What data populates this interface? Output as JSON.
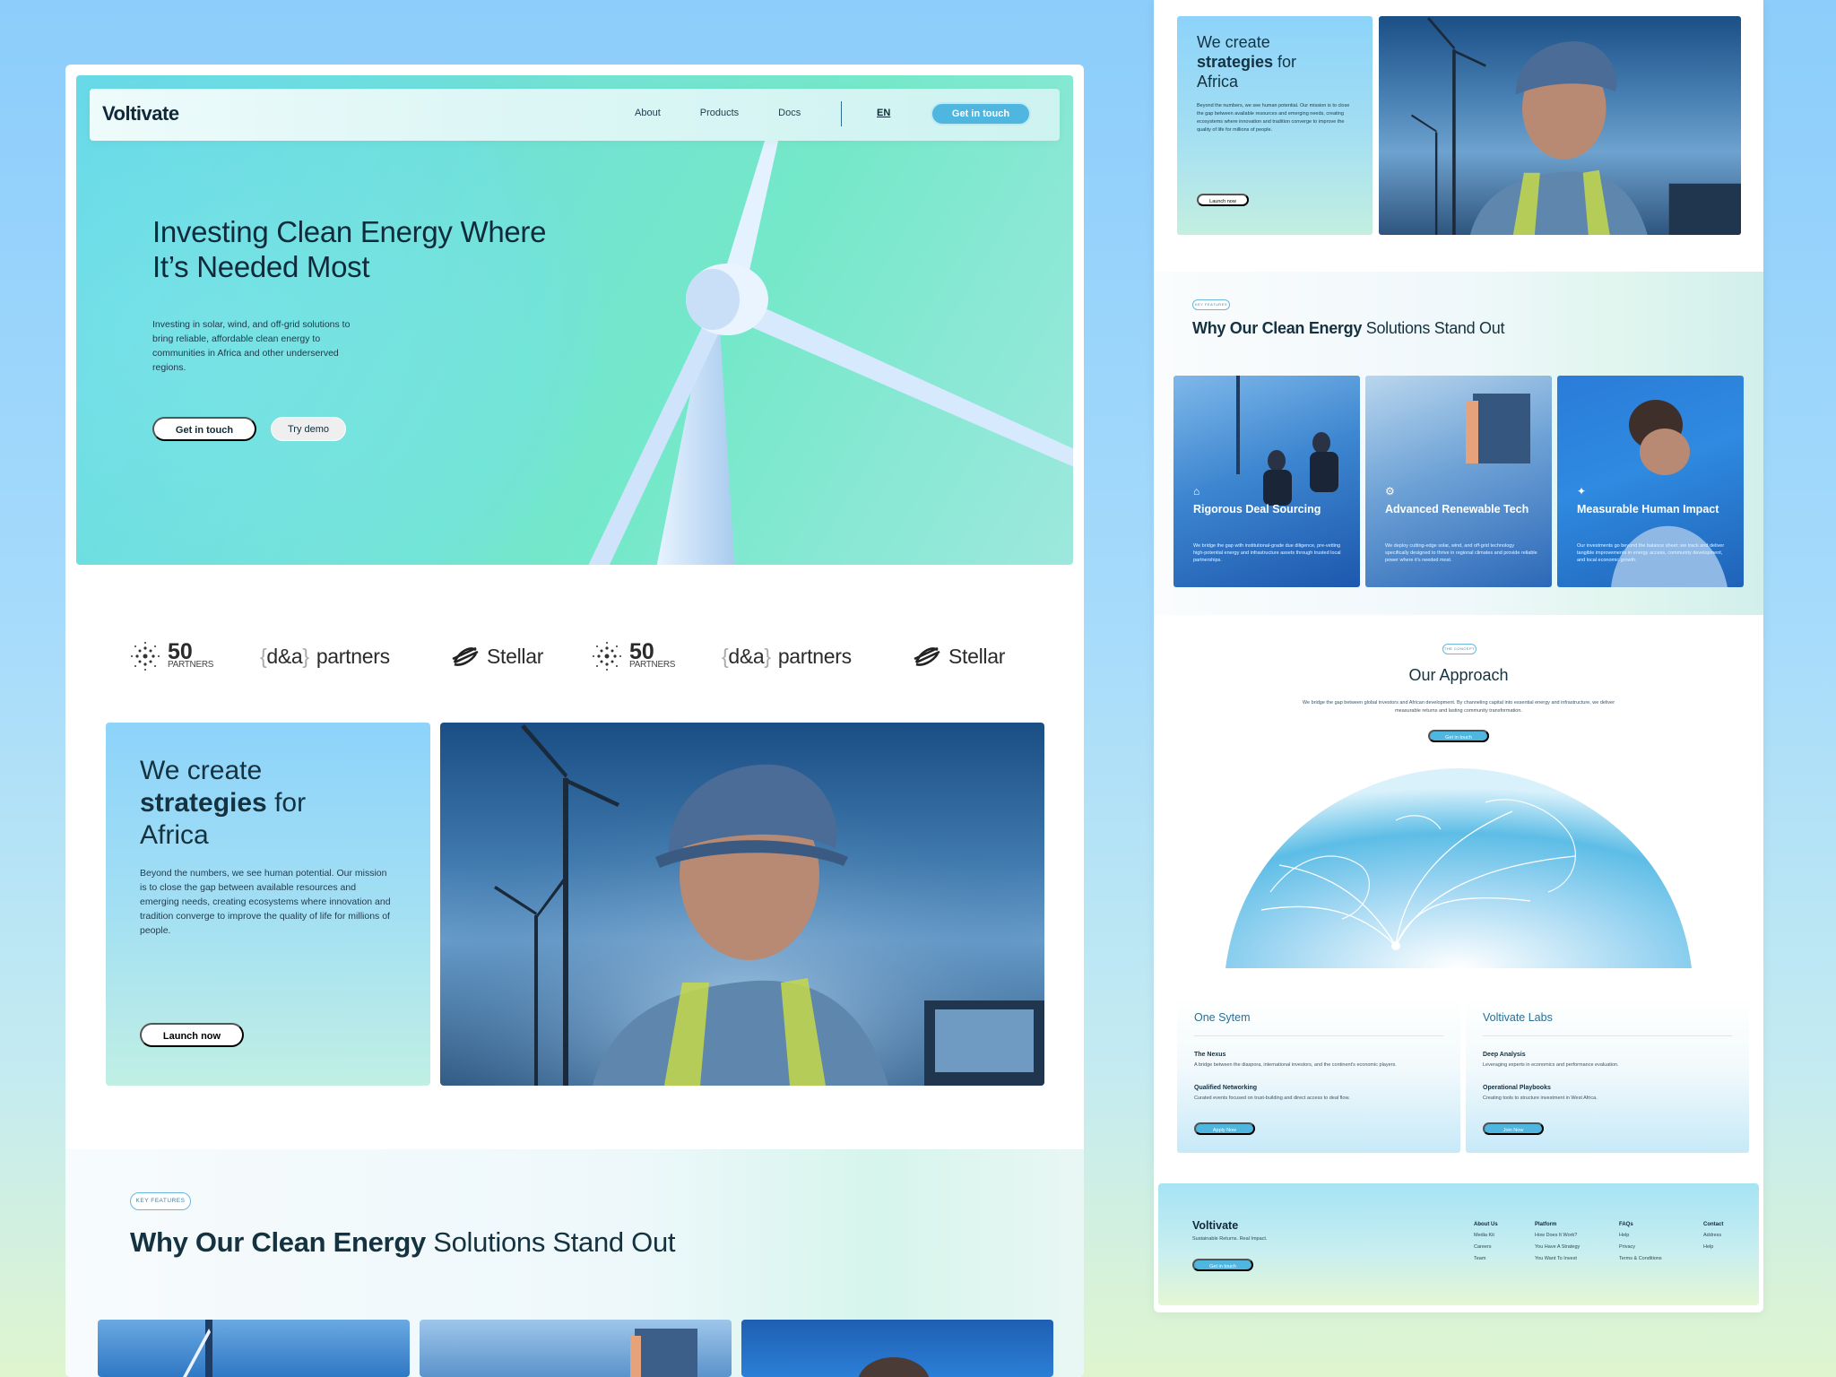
{
  "brand": {
    "name": "Voltivate",
    "accent": "#4fb6e0",
    "text": "#0f2a3a"
  },
  "nav": {
    "links": [
      "About",
      "Products",
      "Docs"
    ],
    "lang": "EN",
    "cta": "Get in touch"
  },
  "hero": {
    "title": "Investing Clean Energy Where It’s Needed Most",
    "subtitle": "Investing in solar, wind, and off-grid solutions to bring reliable, affordable clean energy to communities in Africa and other underserved regions.",
    "primary_button": "Get in touch",
    "secondary_button": "Try demo"
  },
  "partners": [
    {
      "kind": "fifty",
      "top": "50",
      "bottom": "PARTNERS"
    },
    {
      "kind": "da",
      "open": "{",
      "name": "d&a",
      "close": "}",
      "rest": "partners"
    },
    {
      "kind": "stellar",
      "name": "Stellar"
    },
    {
      "kind": "fifty",
      "top": "50",
      "bottom": "PARTNERS"
    },
    {
      "kind": "da",
      "open": "{",
      "name": "d&a",
      "close": "}",
      "rest": "partners"
    },
    {
      "kind": "stellar",
      "name": "Stellar"
    }
  ],
  "strategy": {
    "line1": "We create",
    "bold": "strategies",
    "line2_rest": " for",
    "line3": "Africa",
    "body": "Beyond the numbers, we see human potential. Our mission is to close the gap between available resources and emerging needs, creating ecosystems where innovation and tradition converge to improve the quality of life for millions of people.",
    "button": "Launch now"
  },
  "features": {
    "pill": "KEY FEATURES",
    "title_bold": "Why Our Clean Energy",
    "title_rest": " Solutions Stand Out",
    "cards": [
      {
        "icon": "bank-icon",
        "glyph": "⌂",
        "title": "Rigorous Deal Sourcing",
        "desc": "We bridge the gap with institutional-grade due diligence, pre-vetting high-potential energy and infrastructure assets through trusted local partnerships."
      },
      {
        "icon": "network-icon",
        "glyph": "⚙",
        "title": "Advanced Renewable Tech",
        "desc": "We deploy cutting-edge solar, wind, and off-grid technology specifically designed to thrive in regional climates and provide reliable power where it's needed most."
      },
      {
        "icon": "person-icon",
        "glyph": "✦",
        "title": "Measurable Human Impact",
        "desc": "Our investments go beyond the balance sheet; we track and deliver tangible improvements in energy access, community development, and local economic growth."
      }
    ]
  },
  "approach": {
    "pill": "THE CONCEPT",
    "title": "Our Approach",
    "body": "We bridge the gap between global investors and African development. By channeling capital into essential energy and infrastructure, we deliver measurable returns and lasting community transformation.",
    "button": "Get in touch"
  },
  "systems": [
    {
      "title": "One Sytem",
      "items": [
        {
          "name": "The Nexus",
          "desc": "A bridge between the diaspora, international investors, and the continent's economic players."
        },
        {
          "name": "Qualified Networking",
          "desc": "Curated events focused on trust-building and direct access to deal flow."
        }
      ],
      "button": "Apply Now"
    },
    {
      "title": "Voltivate Labs",
      "items": [
        {
          "name": "Deep Analysis",
          "desc": "Leveraging experts in economics and performance evaluation."
        },
        {
          "name": "Operational Playbooks",
          "desc": "Creating tools to structure investment in West Africa."
        }
      ],
      "button": "Join Now"
    }
  ],
  "footer": {
    "brand": "Voltivate",
    "tagline": "Sustainable Returns. Real Impact.",
    "button": "Get in touch",
    "columns": [
      {
        "head": "About Us",
        "links": [
          "Media Kit",
          "Careers",
          "Team"
        ]
      },
      {
        "head": "Platform",
        "links": [
          "How Does It Work?",
          "You Have A Strategy",
          "You Want To Invest"
        ]
      },
      {
        "head": "FAQs",
        "links": [
          "Help",
          "Privacy",
          "Terms & Conditions"
        ]
      },
      {
        "head": "Contact",
        "links": [
          "Address",
          "Help"
        ]
      }
    ]
  }
}
